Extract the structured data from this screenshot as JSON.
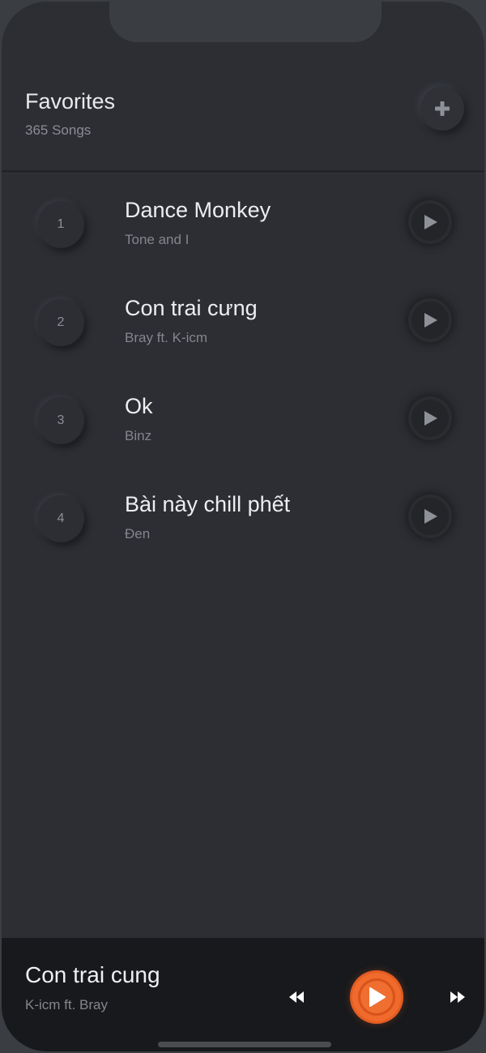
{
  "header": {
    "title": "Favorites",
    "song_count": "365 Songs",
    "add_icon": "plus-icon"
  },
  "songs": [
    {
      "number": "1",
      "title": "Dance Monkey",
      "artist": "Tone and I"
    },
    {
      "number": "2",
      "title": "Con trai cưng",
      "artist": "Bray ft. K-icm"
    },
    {
      "number": "3",
      "title": "Ok",
      "artist": "Binz"
    },
    {
      "number": "4",
      "title": "Bài này chill phết",
      "artist": "Đen"
    }
  ],
  "now_playing": {
    "title": "Con trai cung",
    "artist": "K-icm ft. Bray",
    "icons": [
      "rewind-icon",
      "play-icon",
      "fast-forward-icon"
    ]
  },
  "colors": {
    "background": "#2c2e33",
    "player_bar": "#18191c",
    "accent": "#f06a2c"
  }
}
